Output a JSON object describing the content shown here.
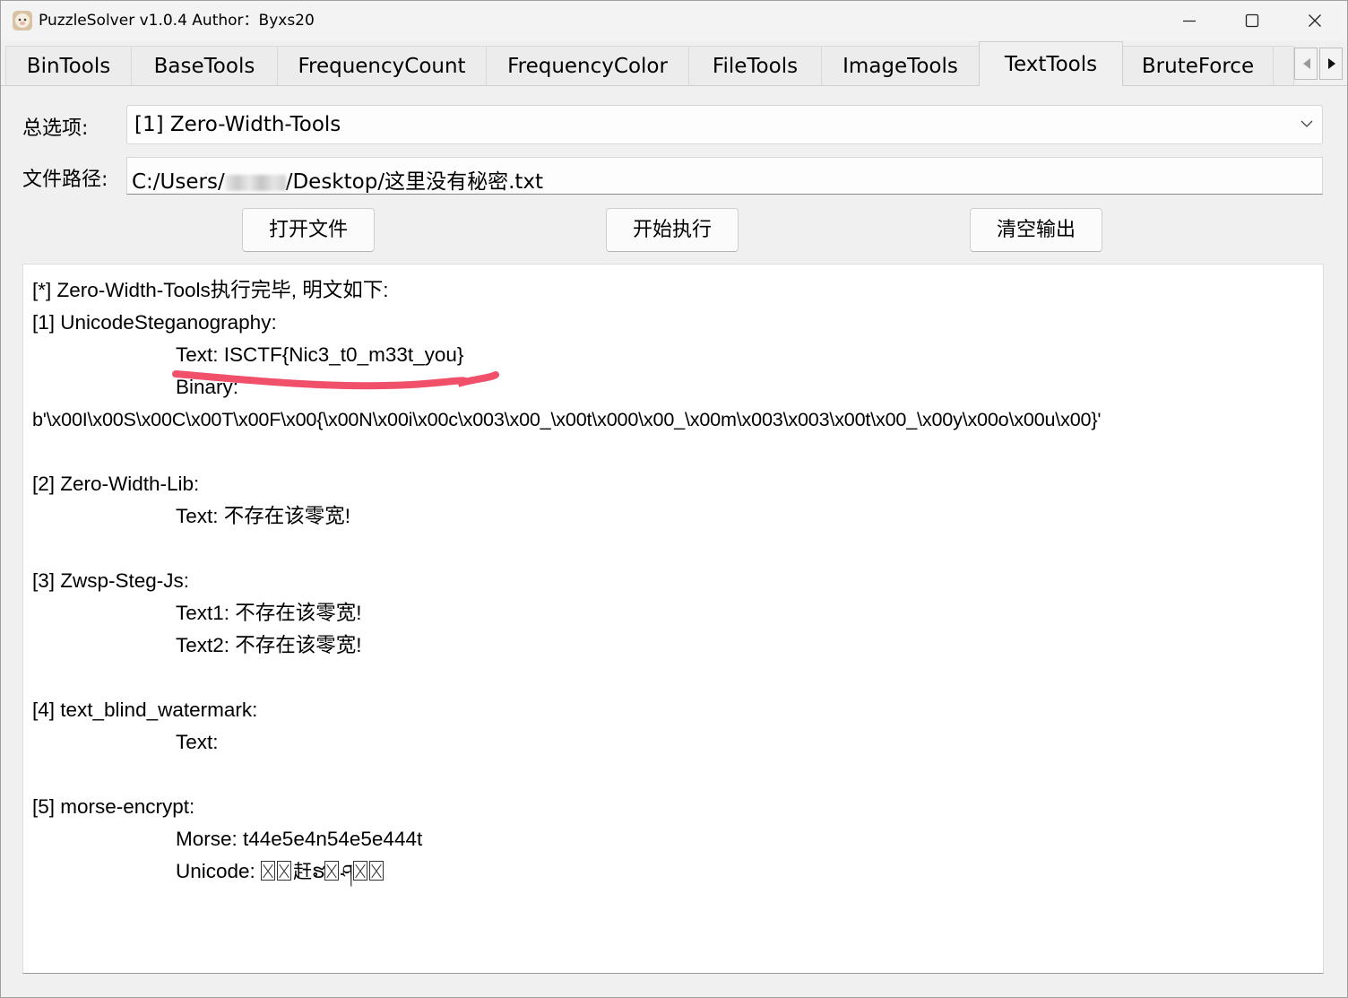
{
  "window": {
    "title": "PuzzleSolver v1.0.4  Author：Byxs20",
    "app_icon": "sheep-icon",
    "controls": [
      "minimize-icon",
      "maximize-icon",
      "close-icon"
    ]
  },
  "tabs": [
    {
      "label": "BinTools",
      "active": false
    },
    {
      "label": "BaseTools",
      "active": false
    },
    {
      "label": "FrequencyCount",
      "active": false
    },
    {
      "label": "FrequencyColor",
      "active": false
    },
    {
      "label": "FileTools",
      "active": false
    },
    {
      "label": "ImageTools",
      "active": false
    },
    {
      "label": "TextTools",
      "active": true
    },
    {
      "label": "BruteForce",
      "active": false
    }
  ],
  "form": {
    "option_label": "总选项:",
    "option_value": "[1] Zero-Width-Tools",
    "path_label": "文件路径:",
    "path_prefix": "C:/Users/",
    "path_suffix": "/Desktop/这里没有秘密.txt"
  },
  "buttons": {
    "open": "打开文件",
    "run": "开始执行",
    "clear": "清空输出"
  },
  "output": {
    "header": "[*] Zero-Width-Tools执行完毕, 明文如下:",
    "s1_title": "[1] UnicodeSteganography:",
    "s1_text": "Text: ISCTF{Nic3_t0_m33t_you}",
    "s1_binary_label": "Binary:",
    "s1_binary": "b'\\x00I\\x00S\\x00C\\x00T\\x00F\\x00{\\x00N\\x00i\\x00c\\x003\\x00_\\x00t\\x000\\x00_\\x00m\\x003\\x003\\x00t\\x00_\\x00y\\x00o\\x00u\\x00}'",
    "s2_title": "[2] Zero-Width-Lib:",
    "s2_text": "Text: 不存在该零宽!",
    "s3_title": "[3] Zwsp-Steg-Js:",
    "s3_text1": "Text1: 不存在该零宽!",
    "s3_text2": "Text2: 不存在该零宽!",
    "s4_title": "[4] text_blind_watermark:",
    "s4_text": "Text:",
    "s5_title": "[5] morse-encrypt:",
    "s5_morse": "Morse: t44e5e4n54e5e444t",
    "s5_unicode_label": "Unicode: ",
    "s5_unicode_c1": "赶",
    "s5_unicode_c2": "ຮ",
    "s5_unicode_c3": "ཤ"
  },
  "annotation": {
    "underline_color": "#f0506a"
  }
}
